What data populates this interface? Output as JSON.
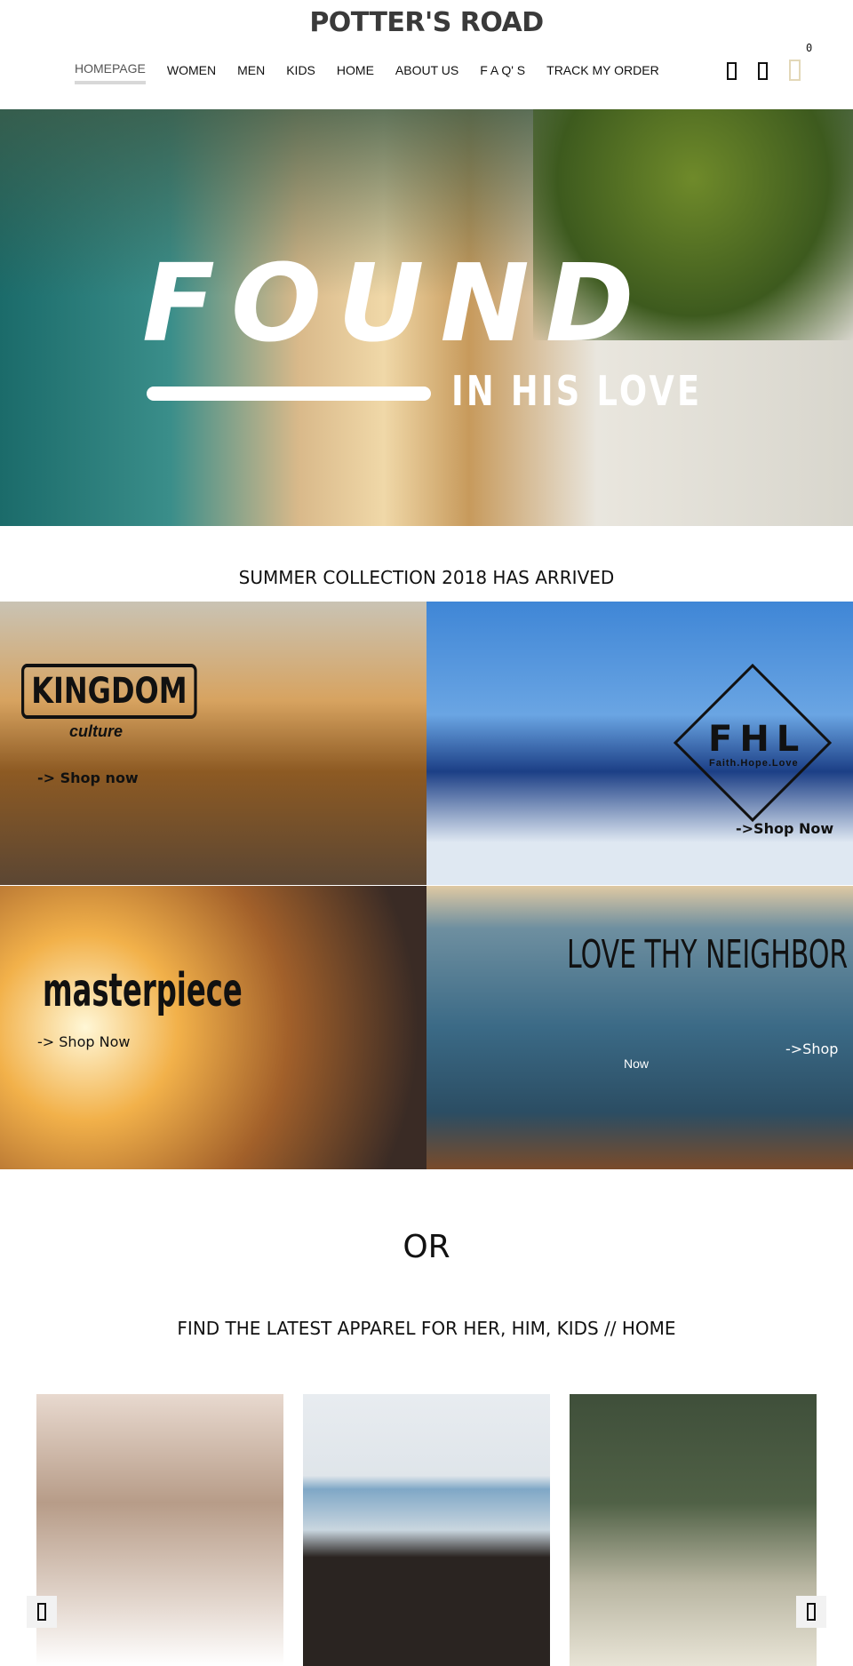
{
  "header": {
    "logo": "POTTER'S ROAD",
    "nav": [
      "HOMEPAGE",
      "WOMEN",
      "MEN",
      "KIDS",
      "HOME",
      "ABOUT US",
      "F A Q' S",
      "TRACK MY ORDER"
    ],
    "cart_count": "0",
    "accent": "#e3d8b8"
  },
  "hero": {
    "title": "FOUND",
    "subtitle": "IN HIS LOVE"
  },
  "collection": {
    "heading": "SUMMER COLLECTION 2018 HAS ARRIVED",
    "tiles": [
      {
        "brand": "KINGDOM",
        "brand_sub": "culture",
        "cta": "-> Shop now"
      },
      {
        "brand": "FHL",
        "brand_sub": "Faith.Hope.Love",
        "cta": "->Shop Now"
      },
      {
        "brand": "masterpiece",
        "cta": "-> Shop Now"
      },
      {
        "brand": "LOVE THY NEIGHBOR",
        "cta": "->Shop",
        "cta2": "Now"
      }
    ]
  },
  "or": "OR",
  "apparel": {
    "heading": "FIND THE LATEST APPAREL FOR HER, HIM, KIDS // HOME"
  }
}
